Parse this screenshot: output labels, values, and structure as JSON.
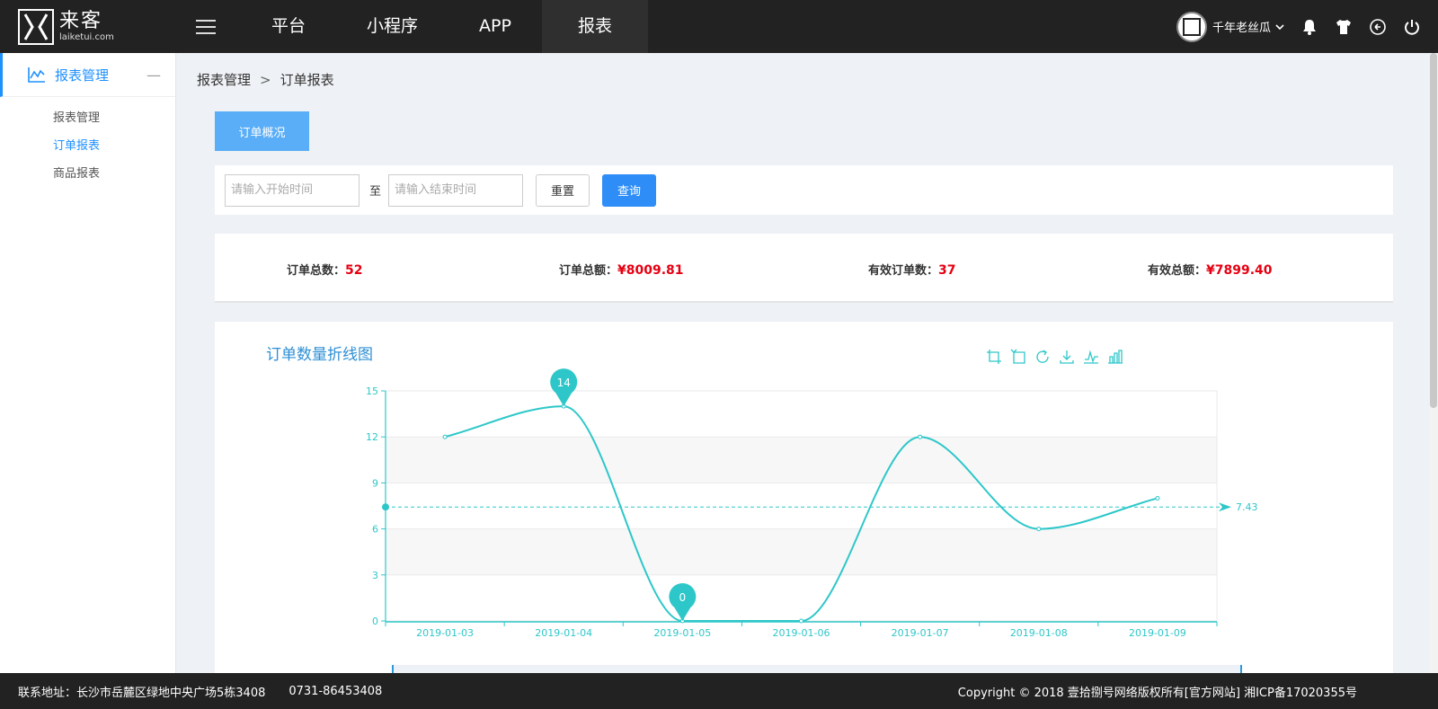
{
  "app": {
    "logo_cn": "来客",
    "logo_en": "laiketui.com"
  },
  "nav": {
    "items": [
      {
        "label": "平台"
      },
      {
        "label": "小程序"
      },
      {
        "label": "APP"
      },
      {
        "label": "报表"
      }
    ],
    "active_index": 3
  },
  "user": {
    "name": "千年老丝瓜"
  },
  "top_icons": [
    "bell-icon",
    "shirt-icon",
    "refresh-icon",
    "power-icon"
  ],
  "sidebar": {
    "section_label": "报表管理",
    "collapse_symbol": "—",
    "items": [
      {
        "label": "报表管理"
      },
      {
        "label": "订单报表"
      },
      {
        "label": "商品报表"
      }
    ],
    "active_index": 1
  },
  "breadcrumb": {
    "parent": "报表管理",
    "separator": ">",
    "current": "订单报表"
  },
  "tab": {
    "label": "订单概况"
  },
  "filter": {
    "start_placeholder": "请输入开始时间",
    "to_label": "至",
    "end_placeholder": "请输入结束时间",
    "reset_label": "重置",
    "query_label": "查询"
  },
  "stats": [
    {
      "label": "订单总数：",
      "value": "52"
    },
    {
      "label": "订单总额：",
      "value": "¥8009.81"
    },
    {
      "label": "有效订单数：",
      "value": "37"
    },
    {
      "label": "有效总额：",
      "value": "¥7899.40"
    }
  ],
  "toolbox": [
    "zoom-icon",
    "zoom-reset-icon",
    "restore-icon",
    "download-icon",
    "line-chart-icon",
    "bar-chart-icon"
  ],
  "chart_data": {
    "type": "line",
    "title": "订单数量折线图",
    "categories": [
      "2019-01-03",
      "2019-01-04",
      "2019-01-05",
      "2019-01-06",
      "2019-01-07",
      "2019-01-08",
      "2019-01-09"
    ],
    "series": [
      {
        "values": [
          12,
          14,
          0,
          0,
          12,
          6,
          8
        ]
      }
    ],
    "yticks": [
      0,
      3,
      6,
      9,
      12,
      15
    ],
    "ylim": [
      0,
      15
    ],
    "max_marker": {
      "label": "14",
      "index": 1
    },
    "min_marker": {
      "label": "0",
      "index": 2
    },
    "average_line": {
      "value": 7.43,
      "label": "7.43"
    },
    "grid": true,
    "color": "#2ec7c9"
  },
  "footer": {
    "address": "联系地址：长沙市岳麓区绿地中央广场5栋3408",
    "phone": "0731-86453408",
    "copyright": "Copyright © 2018 壹拾捌号网络版权所有[官方网站]   湘ICP备17020355号"
  }
}
